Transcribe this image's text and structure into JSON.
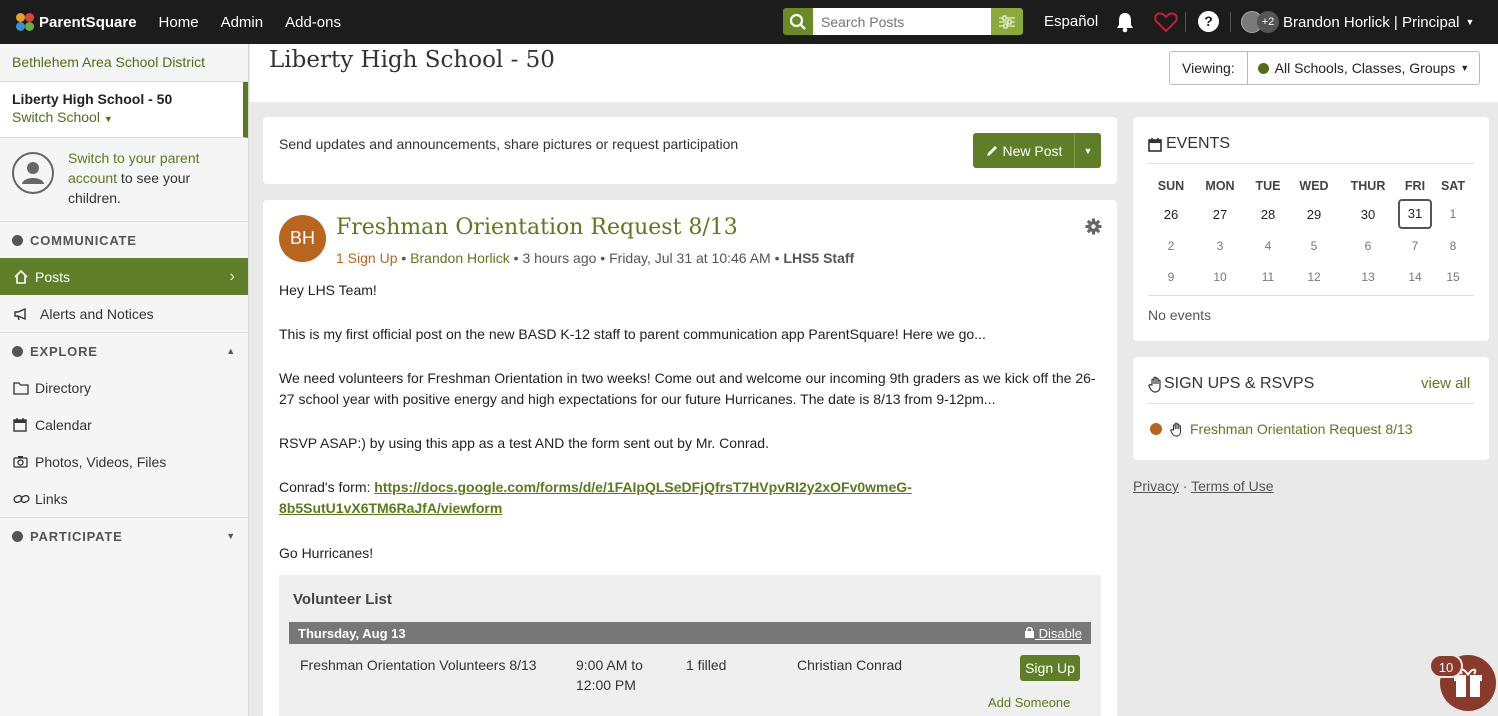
{
  "topbar": {
    "brand": "ParentSquare",
    "nav": [
      "Home",
      "Admin",
      "Add-ons"
    ],
    "search_placeholder": "Search Posts",
    "language": "Español",
    "help": "?",
    "user_extra": "+2",
    "user_label": "Brandon Horlick | Principal"
  },
  "sidebar": {
    "district": "Bethlehem Area School District",
    "school_name": "Liberty High School - 50",
    "switch_school": "Switch School",
    "parent_link": "Switch to your parent account",
    "parent_text": " to see your children.",
    "communicate": "COMMUNICATE",
    "posts": "Posts",
    "alerts": "Alerts and Notices",
    "explore": "EXPLORE",
    "directory": "Directory",
    "calendar": "Calendar",
    "photos": "Photos, Videos, Files",
    "links": "Links",
    "participate": "PARTICIPATE"
  },
  "header": {
    "title": "Liberty High School - 50",
    "viewing_label": "Viewing:",
    "viewing_value": "All Schools, Classes, Groups"
  },
  "compose": {
    "prompt": "Send updates and announcements, share pictures or request participation",
    "new_post": "New Post"
  },
  "post": {
    "initials": "BH",
    "title": "Freshman Orientation Request 8/13",
    "signups": "1 Sign Up",
    "author": "Brandon Horlick",
    "time_ago": "3 hours ago",
    "datetime": "Friday, Jul 31 at 10:46 AM",
    "group": "LHS5 Staff",
    "greeting": "Hey LHS Team!",
    "para1": "This is my first official post on the new BASD K-12 staff to parent communication app ParentSquare! Here we go...",
    "para2": "We need volunteers for Freshman Orientation in two weeks! Come out and welcome our incoming 9th graders as we kick off the 26-27 school year with positive energy and high expectations for our future Hurricanes. The date is 8/13 from 9-12pm...",
    "para3": "RSVP ASAP:) by using this app as a test AND the form sent out by Mr. Conrad.",
    "form_label": "Conrad's form: ",
    "form_url": "https://docs.google.com/forms/d/e/1FAIpQLSeDFjQfrsT7HVpvRI2y2xOFv0wmeG-8b5SutU1vX6TM6RaJfA/viewform",
    "closing": "Go Hurricanes!"
  },
  "volunteer": {
    "title": "Volunteer List",
    "date": "Thursday, Aug 13",
    "disable": "Disable",
    "slot_name": "Freshman Orientation Volunteers 8/13",
    "slot_time": "9:00 AM to 12:00 PM",
    "filled": "1 filled",
    "volunteer": "Christian Conrad",
    "signup": "Sign Up",
    "add_someone": "Add Someone"
  },
  "events": {
    "title": "EVENTS",
    "days": [
      "SUN",
      "MON",
      "TUE",
      "WED",
      "THUR",
      "FRI",
      "SAT"
    ],
    "weeks": [
      [
        "26",
        "27",
        "28",
        "29",
        "30",
        "31",
        "1"
      ],
      [
        "2",
        "3",
        "4",
        "5",
        "6",
        "7",
        "8"
      ],
      [
        "9",
        "10",
        "11",
        "12",
        "13",
        "14",
        "15"
      ]
    ],
    "today": "31",
    "empty": "No events"
  },
  "signups_card": {
    "title": "SIGN UPS & RSVPS",
    "view_all": "view all",
    "item": "Freshman Orientation Request 8/13"
  },
  "footer": {
    "privacy": "Privacy",
    "terms": "Terms of Use"
  },
  "gift_count": "10"
}
